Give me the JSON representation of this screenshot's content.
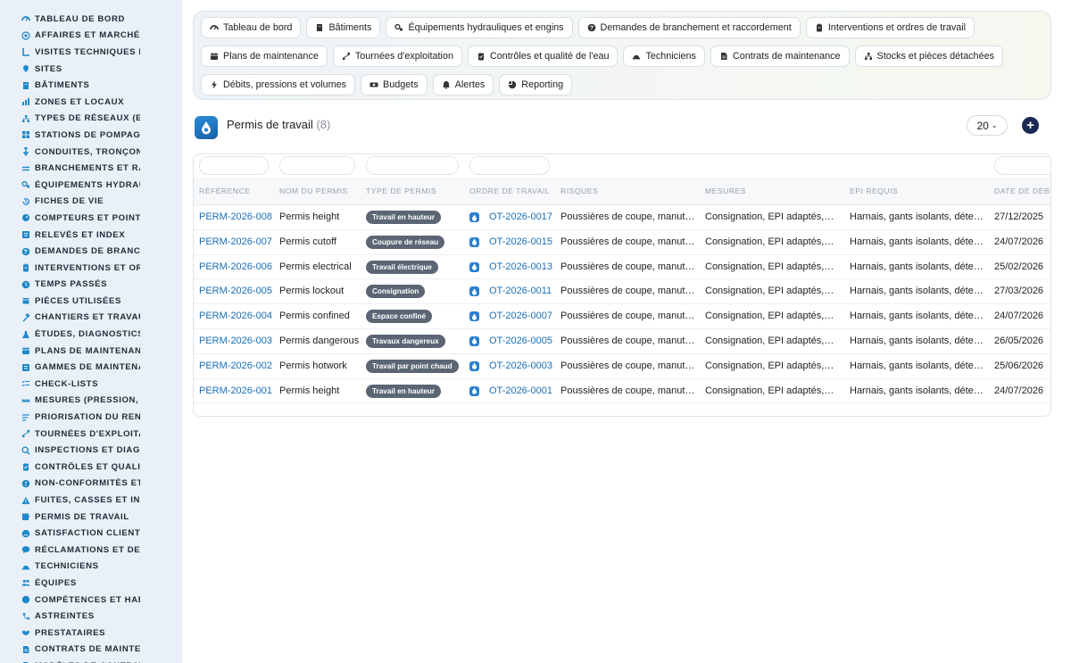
{
  "sidebar": {
    "items": [
      {
        "label": "TABLEAU DE BORD",
        "icon": "dashboard-icon"
      },
      {
        "label": "AFFAIRES ET MARCHÉS",
        "icon": "target-icon"
      },
      {
        "label": "VISITES TECHNIQUES ET",
        "icon": "map-path-icon"
      },
      {
        "label": "SITES",
        "icon": "map-pin-icon"
      },
      {
        "label": "BÂTIMENTS",
        "icon": "building-icon"
      },
      {
        "label": "ZONES ET LOCAUX",
        "icon": "rooms-icon"
      },
      {
        "label": "TYPES DE RÉSEAUX (EAU",
        "icon": "network-icon"
      },
      {
        "label": "STATIONS DE POMPAGE E",
        "icon": "grid-icon"
      },
      {
        "label": "CONDUITES, TRONÇONS",
        "icon": "faucet-icon"
      },
      {
        "label": "BRANCHEMENTS ET RAC",
        "icon": "lines-icon"
      },
      {
        "label": "ÉQUIPEMENTS HYDRAUL",
        "icon": "gears-icon"
      },
      {
        "label": "FICHES DE VIE",
        "icon": "history-icon"
      },
      {
        "label": "COMPTEURS ET POINTS D",
        "icon": "gauge-icon"
      },
      {
        "label": "RELEVÉS ET INDEX",
        "icon": "list-icon"
      },
      {
        "label": "DEMANDES DE BRANCHE",
        "icon": "question-icon"
      },
      {
        "label": "INTERVENTIONS ET ORDI",
        "icon": "clipboard-icon"
      },
      {
        "label": "TEMPS PASSÉS",
        "icon": "clock-icon"
      },
      {
        "label": "PIÈCES UTILISÉES",
        "icon": "box-icon"
      },
      {
        "label": "CHANTIERS ET TRAVAUX",
        "icon": "hammer-icon"
      },
      {
        "label": "ÉTUDES, DIAGNOSTICS E",
        "icon": "flask-icon"
      },
      {
        "label": "PLANS DE MAINTENANCE",
        "icon": "calendar-icon"
      },
      {
        "label": "GAMMES DE MAINTENAN",
        "icon": "list-icon"
      },
      {
        "label": "CHECK-LISTS",
        "icon": "checklist-icon"
      },
      {
        "label": "MESURES (PRESSION, DÉ",
        "icon": "ruler-icon"
      },
      {
        "label": "PRIORISATION DU RENOU",
        "icon": "sort-icon"
      },
      {
        "label": "TOURNÉES D'EXPLOITATI",
        "icon": "route-icon"
      },
      {
        "label": "INSPECTIONS ET DIAGNO",
        "icon": "search-icon"
      },
      {
        "label": "CONTRÔLES ET QUALITÉ",
        "icon": "clipboard-check-icon"
      },
      {
        "label": "NON-CONFORMITÉS ET A",
        "icon": "alert-circle-icon"
      },
      {
        "label": "FUITES, CASSES ET INCI",
        "icon": "warning-icon"
      },
      {
        "label": "PERMIS DE TRAVAIL",
        "icon": "permit-icon"
      },
      {
        "label": "SATISFACTION CLIENT",
        "icon": "smile-icon"
      },
      {
        "label": "RÉCLAMATIONS ET DEMA",
        "icon": "comment-icon"
      },
      {
        "label": "TECHNICIENS",
        "icon": "hardhat-icon"
      },
      {
        "label": "ÉQUIPES",
        "icon": "users-icon"
      },
      {
        "label": "COMPÉTENCES ET HABIL",
        "icon": "badge-icon"
      },
      {
        "label": "ASTREINTES",
        "icon": "phone-icon"
      },
      {
        "label": "PRESTATAIRES",
        "icon": "handshake-icon"
      },
      {
        "label": "CONTRATS DE MAINTENA",
        "icon": "contract-icon"
      },
      {
        "label": "MODÈLES DE CONTRATS",
        "icon": "document-icon"
      }
    ]
  },
  "toolbar": {
    "rows": [
      [
        {
          "label": "Tableau de bord",
          "icon": "dashboard-icon"
        },
        {
          "label": "Bâtiments",
          "icon": "building-icon"
        },
        {
          "label": "Équipements hydrauliques et engins",
          "icon": "gears-icon"
        },
        {
          "label": "Demandes de branchement et raccordement",
          "icon": "question-icon"
        },
        {
          "label": "Interventions et ordres de travail",
          "icon": "clipboard-icon"
        }
      ],
      [
        {
          "label": "Plans de maintenance",
          "icon": "calendar-icon"
        },
        {
          "label": "Tournées d'exploitation",
          "icon": "route-icon"
        },
        {
          "label": "Contrôles et qualité de l'eau",
          "icon": "clipboard-check-icon"
        },
        {
          "label": "Techniciens",
          "icon": "hardhat-icon"
        },
        {
          "label": "Contrats de maintenance",
          "icon": "contract-icon"
        },
        {
          "label": "Stocks et pièces détachées",
          "icon": "network-icon"
        }
      ],
      [
        {
          "label": "Débits, pressions et volumes",
          "icon": "bolt-icon"
        },
        {
          "label": "Budgets",
          "icon": "money-icon"
        },
        {
          "label": "Alertes",
          "icon": "bell-icon"
        },
        {
          "label": "Reporting",
          "icon": "pie-chart-icon"
        }
      ]
    ]
  },
  "page": {
    "title": "Permis de travail",
    "count": "(8)",
    "per_page": "20",
    "add_label": "+"
  },
  "table": {
    "columns": [
      "RÉFÉRENCE",
      "NOM DU PERMIS",
      "TYPE DE PERMIS",
      "ORDRE DE TRAVAIL",
      "RISQUES",
      "MESURES",
      "EPI REQUIS",
      "DATE DE DÉBU"
    ],
    "rows": [
      {
        "ref": "PERM-2026-008",
        "name": "Permis height",
        "type": "Travail en hauteur",
        "ot": "OT-2026-0017",
        "risques": "Poussières de coupe, manutention",
        "mesures": "Consignation, EPI adaptés, signalisation",
        "epi": "Harnais, gants isolants, détecteur",
        "date": "27/12/2025"
      },
      {
        "ref": "PERM-2026-007",
        "name": "Permis cutoff",
        "type": "Coupure de réseau",
        "ot": "OT-2026-0015",
        "risques": "Poussières de coupe, manutention",
        "mesures": "Consignation, EPI adaptés, signalisation",
        "epi": "Harnais, gants isolants, détecteur",
        "date": "24/07/2026"
      },
      {
        "ref": "PERM-2026-006",
        "name": "Permis electrical",
        "type": "Travail électrique",
        "ot": "OT-2026-0013",
        "risques": "Poussières de coupe, manutention",
        "mesures": "Consignation, EPI adaptés, signalisation",
        "epi": "Harnais, gants isolants, détecteur",
        "date": "25/02/2026"
      },
      {
        "ref": "PERM-2026-005",
        "name": "Permis lockout",
        "type": "Consignation",
        "ot": "OT-2026-0011",
        "risques": "Poussières de coupe, manutention",
        "mesures": "Consignation, EPI adaptés, signalisation",
        "epi": "Harnais, gants isolants, détecteur",
        "date": "27/03/2026"
      },
      {
        "ref": "PERM-2026-004",
        "name": "Permis confined",
        "type": "Espace confiné",
        "ot": "OT-2026-0007",
        "risques": "Poussières de coupe, manutention",
        "mesures": "Consignation, EPI adaptés, signalisation",
        "epi": "Harnais, gants isolants, détecteur",
        "date": "24/07/2026"
      },
      {
        "ref": "PERM-2026-003",
        "name": "Permis dangerous",
        "type": "Travaux dangereux",
        "ot": "OT-2026-0005",
        "risques": "Poussières de coupe, manutention",
        "mesures": "Consignation, EPI adaptés, signalisation",
        "epi": "Harnais, gants isolants, détecteur",
        "date": "26/05/2026"
      },
      {
        "ref": "PERM-2026-002",
        "name": "Permis hotwork",
        "type": "Travail par point chaud",
        "ot": "OT-2026-0003",
        "risques": "Poussières de coupe, manutention",
        "mesures": "Consignation, EPI adaptés, signalisation",
        "epi": "Harnais, gants isolants, détecteur",
        "date": "25/06/2026"
      },
      {
        "ref": "PERM-2026-001",
        "name": "Permis height",
        "type": "Travail en hauteur",
        "ot": "OT-2026-0001",
        "risques": "Poussières de coupe, manutention",
        "mesures": "Consignation, EPI adaptés, signalisation",
        "epi": "Harnais, gants isolants, détecteur",
        "date": "24/07/2026"
      }
    ]
  },
  "colors": {
    "sidebar_bg": "#e9f0f7",
    "icon_blue": "#1e88c9",
    "link_blue": "#1a6fb5",
    "badge_bg": "#5b6573",
    "add_button": "#1b2a55"
  }
}
